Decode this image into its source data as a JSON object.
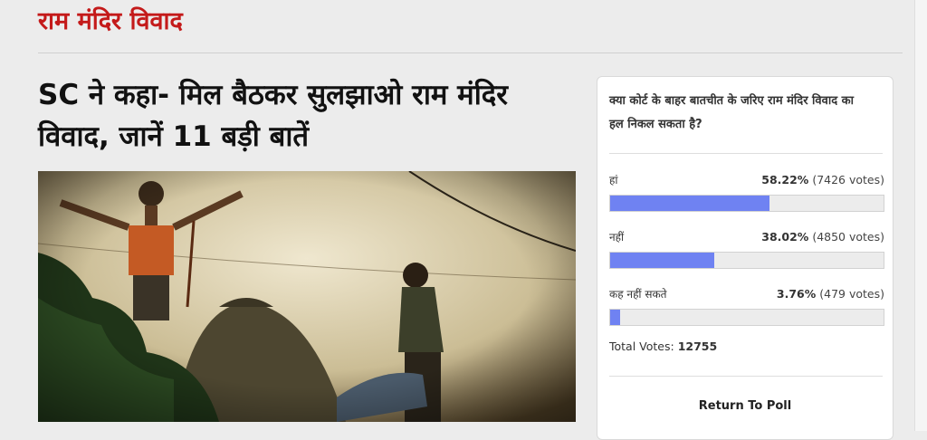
{
  "section": {
    "title": "राम मंदिर विवाद"
  },
  "article": {
    "headline": "SC ने कहा- मिल बैठकर सुलझाओ राम मंदिर विवाद, जानें 11 बड़ी बातें"
  },
  "poll": {
    "question": "क्या कोर्ट के बाहर बातचीत के जरिए राम मंदिर विवाद का हल निकल सकता है?",
    "options": [
      {
        "label": "हां",
        "percent": "58.22%",
        "votes": "(7426 votes)",
        "fraction": 0.5822
      },
      {
        "label": "नहीं",
        "percent": "38.02%",
        "votes": "(4850 votes)",
        "fraction": 0.3802
      },
      {
        "label": "कह नहीं सकते",
        "percent": "3.76%",
        "votes": "(479 votes)",
        "fraction": 0.0376
      }
    ],
    "total_label": "Total Votes:",
    "total_value": "12755",
    "return_label": "Return To Poll",
    "bar_color": "#6f82f2"
  },
  "colors": {
    "section_title": "#c41a1a",
    "page_bg": "#ececec"
  }
}
